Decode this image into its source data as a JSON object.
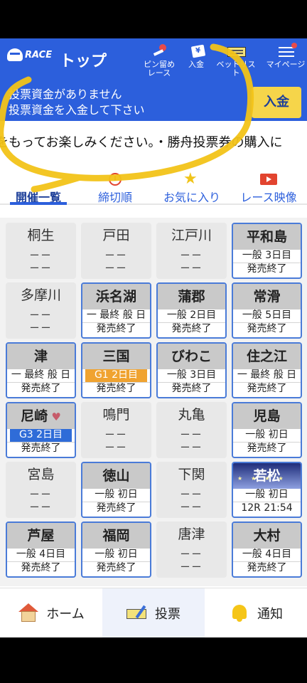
{
  "header": {
    "logo_text": "RACE",
    "title": "トップ",
    "buttons": [
      {
        "label_line1": "ピン留め",
        "label_line2": "レース",
        "icon": "pin-icon"
      },
      {
        "label_line1": "入金",
        "label_line2": "",
        "icon": "yen-card-icon"
      },
      {
        "label_line1": "ベットリスト",
        "label_line2": "",
        "icon": "bet-list-icon"
      },
      {
        "label_line1": "マイページ",
        "label_line2": "",
        "icon": "menu-icon"
      }
    ]
  },
  "fund_notice": {
    "line1": "投票資金がありません",
    "line2": "投票資金を入金して下さい",
    "deposit_label": "入金"
  },
  "ticker": {
    "text": "をもってお楽しみください。・勝舟投票券の購入に"
  },
  "tabs": [
    {
      "label": "開催一覧",
      "icon": "list-icon",
      "active": true
    },
    {
      "label": "締切順",
      "icon": "alarm-clock-icon",
      "active": false
    },
    {
      "label": "お気に入り",
      "icon": "star-icon",
      "active": false
    },
    {
      "label": "レース映像",
      "icon": "video-icon",
      "active": false
    }
  ],
  "venues": [
    {
      "name": "桐生",
      "active": false,
      "line1": "ーー",
      "line2": "ーー"
    },
    {
      "name": "戸田",
      "active": false,
      "line1": "ーー",
      "line2": "ーー"
    },
    {
      "name": "江戸川",
      "active": false,
      "line1": "ーー",
      "line2": "ーー"
    },
    {
      "name": "平和島",
      "active": true,
      "info": "一般 3日目",
      "status": "発売終了"
    },
    {
      "name": "多摩川",
      "active": false,
      "line1": "ーー",
      "line2": "ーー"
    },
    {
      "name": "浜名湖",
      "active": true,
      "info": "一 最終 般 日",
      "status": "発売終了"
    },
    {
      "name": "蒲郡",
      "active": true,
      "info": "一般 2日目",
      "status": "発売終了"
    },
    {
      "name": "常滑",
      "active": true,
      "info": "一般 5日目",
      "status": "発売終了"
    },
    {
      "name": "津",
      "active": true,
      "info": "一 最終 般 日",
      "status": "発売終了"
    },
    {
      "name": "三国",
      "active": true,
      "info": "G1 2日目",
      "grade": "g1",
      "status": "発売終了"
    },
    {
      "name": "びわこ",
      "active": true,
      "info": "一般 3日目",
      "status": "発売終了"
    },
    {
      "name": "住之江",
      "active": true,
      "info": "一 最終 般 日",
      "status": "発売終了"
    },
    {
      "name": "尼崎",
      "active": true,
      "favorite": true,
      "info": "G3 2日目",
      "grade": "g3",
      "status": "発売終了"
    },
    {
      "name": "鳴門",
      "active": false,
      "line1": "ーー",
      "line2": "ーー"
    },
    {
      "name": "丸亀",
      "active": false,
      "line1": "ーー",
      "line2": "ーー"
    },
    {
      "name": "児島",
      "active": true,
      "info": "一般 初日",
      "status": "発売終了"
    },
    {
      "name": "宮島",
      "active": false,
      "line1": "ーー",
      "line2": "ーー"
    },
    {
      "name": "徳山",
      "active": true,
      "info": "一般 初日",
      "status": "発売終了"
    },
    {
      "name": "下関",
      "active": false,
      "line1": "ーー",
      "line2": "ーー"
    },
    {
      "name": "若松",
      "active": true,
      "night": true,
      "info": "一般 初日",
      "status": "12R 21:54"
    },
    {
      "name": "芦屋",
      "active": true,
      "info": "一般 4日目",
      "status": "発売終了"
    },
    {
      "name": "福岡",
      "active": true,
      "info": "一般 初日",
      "status": "発売終了"
    },
    {
      "name": "唐津",
      "active": false,
      "line1": "ーー",
      "line2": "ーー"
    },
    {
      "name": "大村",
      "active": true,
      "info": "一般 4日目",
      "status": "発売終了"
    }
  ],
  "bottom_nav": [
    {
      "label": "ホーム",
      "icon": "home-icon",
      "active": false
    },
    {
      "label": "投票",
      "icon": "ticket-icon",
      "active": true
    },
    {
      "label": "通知",
      "icon": "bell-icon",
      "active": false
    }
  ],
  "colors": {
    "brand_blue": "#2c5fdc",
    "deposit_yellow": "#f6d54a",
    "annotation_yellow": "#f2c318"
  }
}
